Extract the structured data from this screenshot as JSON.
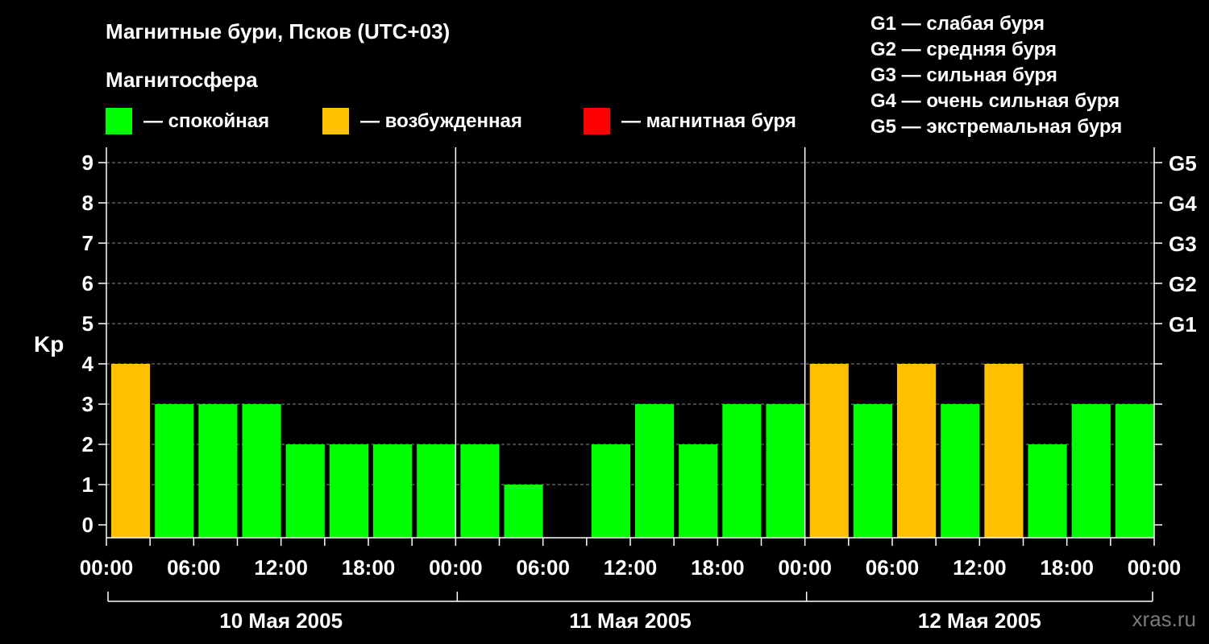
{
  "title": "Магнитные бури, Псков (UTC+03)",
  "legend": {
    "heading": "Магнитосфера",
    "items": [
      {
        "label": "— спокойная",
        "color": "#00ff00"
      },
      {
        "label": "— возбужденная",
        "color": "#ffc000"
      },
      {
        "label": "— магнитная буря",
        "color": "#ff0000"
      }
    ]
  },
  "g_scale": [
    "G1 — слабая буря",
    "G2 — средняя буря",
    "G3 — сильная буря",
    "G4 — очень сильная буря",
    "G5 — экстремальная буря"
  ],
  "watermark": "xras.ru",
  "chart_data": {
    "type": "bar",
    "ylabel": "Kp",
    "ylim": [
      0,
      9
    ],
    "y_ticks": [
      "0",
      "1",
      "2",
      "3",
      "4",
      "5",
      "6",
      "7",
      "8",
      "9"
    ],
    "right_ticks": [
      {
        "value": 5,
        "label": "G1"
      },
      {
        "value": 6,
        "label": "G2"
      },
      {
        "value": 7,
        "label": "G3"
      },
      {
        "value": 8,
        "label": "G4"
      },
      {
        "value": 9,
        "label": "G5"
      }
    ],
    "x_tick_labels": [
      "00:00",
      "06:00",
      "12:00",
      "18:00",
      "00:00",
      "06:00",
      "12:00",
      "18:00",
      "00:00",
      "06:00",
      "12:00",
      "18:00",
      "00:00"
    ],
    "days": [
      "10 Мая 2005",
      "11 Мая 2005",
      "12 Мая 2005"
    ],
    "interval_hours": 3,
    "values": [
      4,
      3,
      3,
      3,
      2,
      2,
      2,
      2,
      2,
      1,
      0,
      2,
      3,
      2,
      3,
      3,
      4,
      3,
      4,
      3,
      4,
      2,
      3,
      3
    ],
    "colors": {
      "quiet": "#00ff00",
      "active": "#ffc000",
      "storm": "#ff0000"
    },
    "grid": true
  }
}
